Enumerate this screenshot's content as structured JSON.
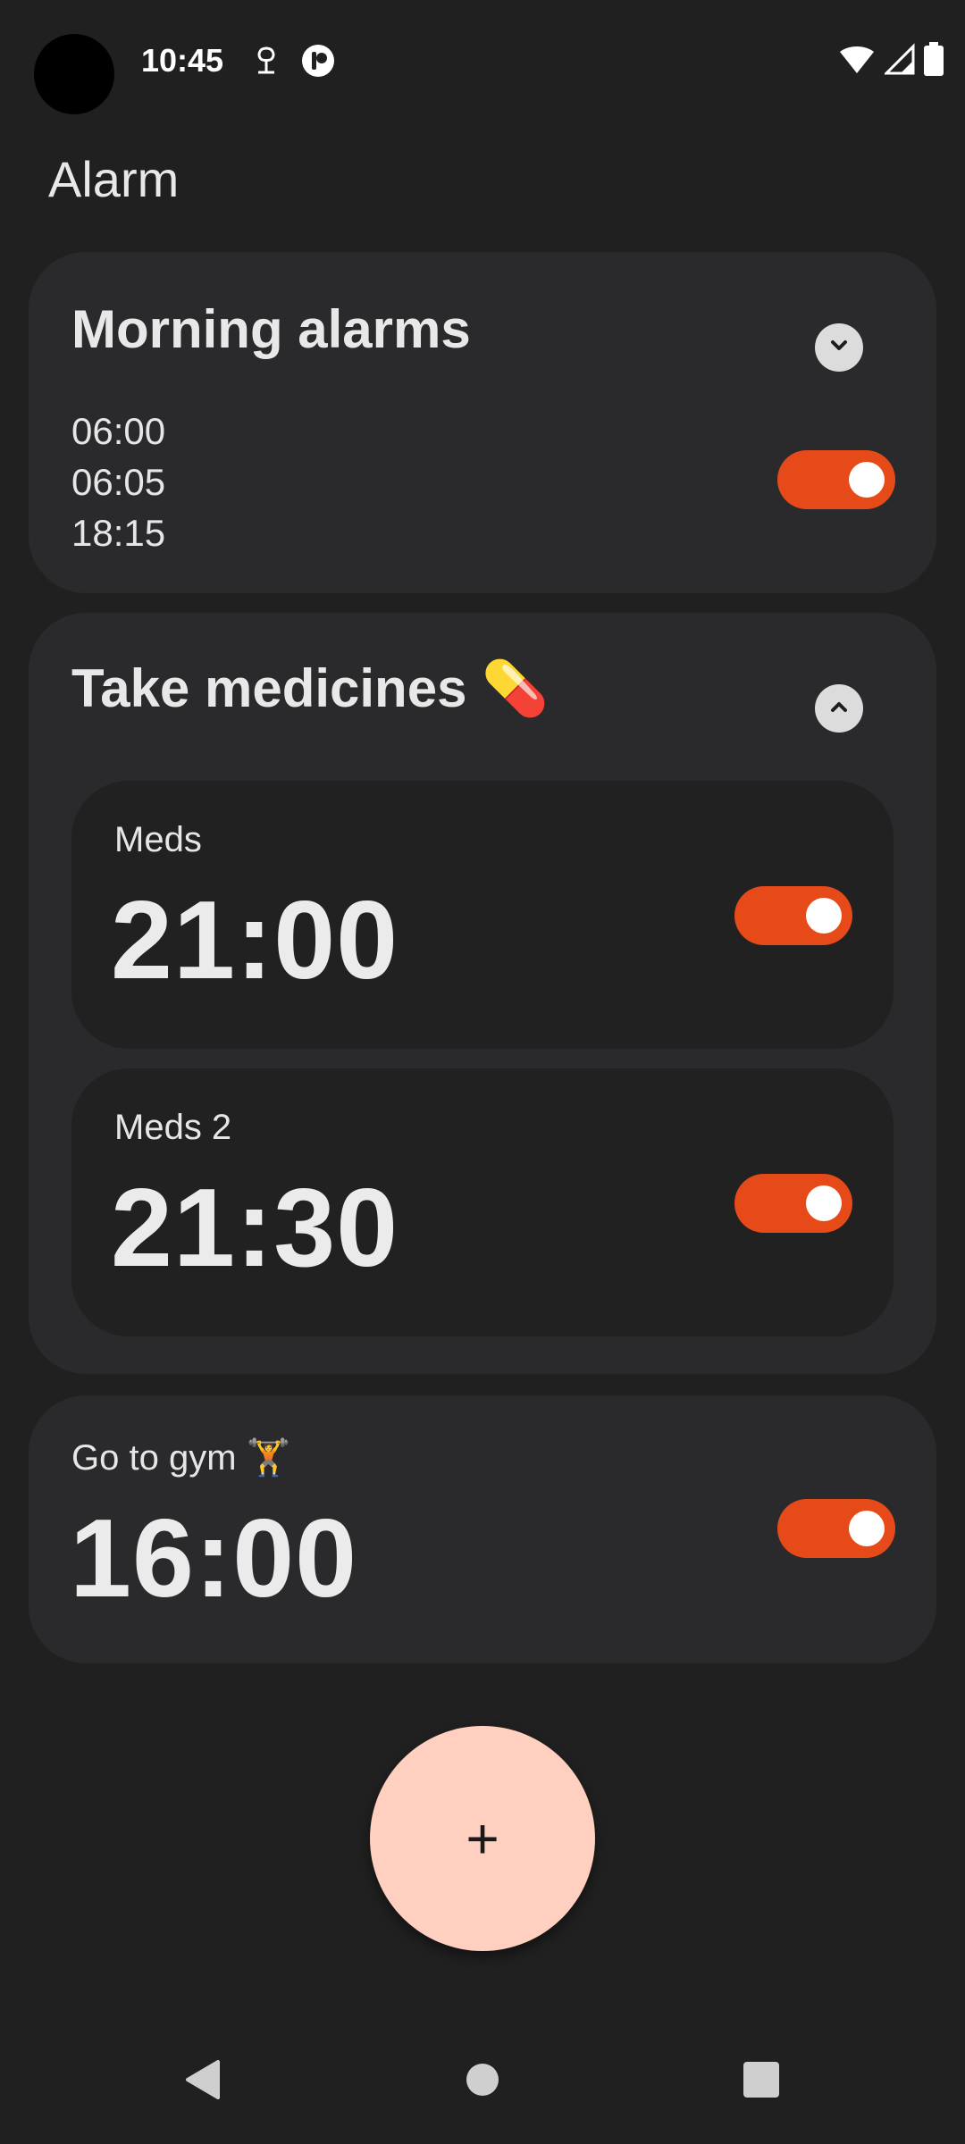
{
  "status_bar": {
    "time": "10:45"
  },
  "app": {
    "title": "Alarm"
  },
  "groups": [
    {
      "title": "Morning alarms",
      "times": [
        "06:00",
        "06:05",
        "18:15"
      ],
      "enabled": true
    },
    {
      "title": "Take medicines 💊",
      "alarms": [
        {
          "label": "Meds",
          "time": "21:00",
          "enabled": true
        },
        {
          "label": "Meds 2",
          "time": "21:30",
          "enabled": true
        }
      ]
    }
  ],
  "single_alarm": {
    "label": "Go to gym 🏋️",
    "time": "16:00",
    "enabled": true
  },
  "fab": {
    "label": "+"
  },
  "colors": {
    "background": "#202020",
    "card": "#2a2a2c",
    "inner_card": "#212121",
    "toggle_on": "#e64a19",
    "fab": "#ffcfbf"
  }
}
